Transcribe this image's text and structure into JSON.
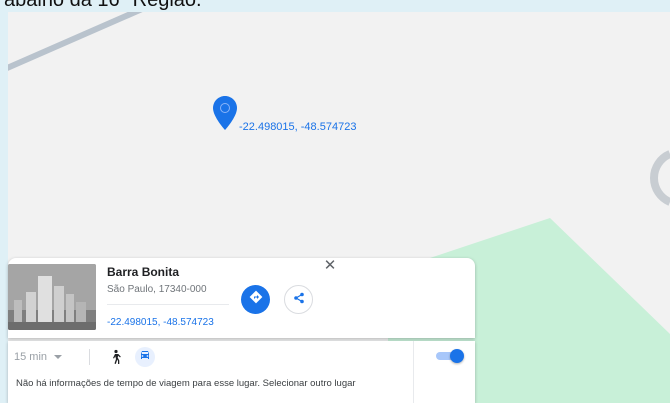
{
  "top_caption": "abalho da 16ª Região.",
  "map": {
    "pin_label": "-22.498015, -48.574723",
    "colors": {
      "background": "#f2f2f2",
      "park": "#c8f0d8",
      "road": "#b9c3cd",
      "pin": "#1a73e8"
    }
  },
  "place_card": {
    "name": "Barra Bonita",
    "address": "São Paulo, 17340-000",
    "coordinates": "-22.498015, -48.574723",
    "directions_icon": "directions-icon",
    "share_icon": "share-icon",
    "close_icon": "close-icon",
    "close_glyph": "✕"
  },
  "travel_panel": {
    "time_option": "15 min",
    "info_text": "Não há informações de tempo de viagem para esse lugar. Selecionar outro lugar",
    "modes": [
      "walk-icon",
      "car-icon"
    ],
    "selected_mode": "car-icon",
    "toggle_on": true
  }
}
